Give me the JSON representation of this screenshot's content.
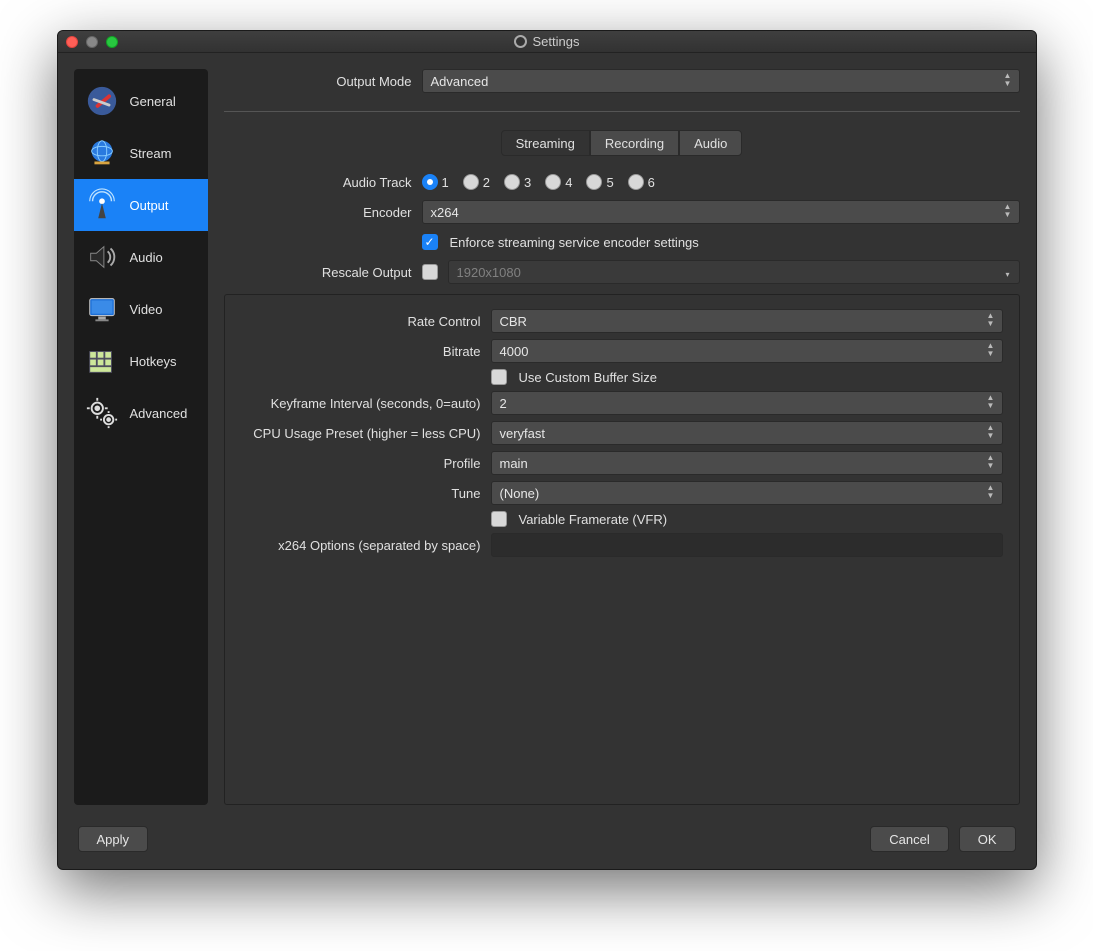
{
  "window": {
    "title": "Settings"
  },
  "sidebar": {
    "items": [
      {
        "label": "General"
      },
      {
        "label": "Stream"
      },
      {
        "label": "Output"
      },
      {
        "label": "Audio"
      },
      {
        "label": "Video"
      },
      {
        "label": "Hotkeys"
      },
      {
        "label": "Advanced"
      }
    ]
  },
  "top": {
    "output_mode_label": "Output Mode",
    "output_mode_value": "Advanced"
  },
  "tabs": {
    "streaming": "Streaming",
    "recording": "Recording",
    "audio": "Audio"
  },
  "stream": {
    "audio_track_label": "Audio Track",
    "tracks": [
      "1",
      "2",
      "3",
      "4",
      "5",
      "6"
    ],
    "encoder_label": "Encoder",
    "encoder_value": "x264",
    "enforce_label": "Enforce streaming service encoder settings",
    "rescale_label": "Rescale Output",
    "rescale_value": "1920x1080"
  },
  "enc": {
    "rate_control_label": "Rate Control",
    "rate_control_value": "CBR",
    "bitrate_label": "Bitrate",
    "bitrate_value": "4000",
    "custom_buffer_label": "Use Custom Buffer Size",
    "keyframe_label": "Keyframe Interval (seconds, 0=auto)",
    "keyframe_value": "2",
    "cpu_label": "CPU Usage Preset (higher = less CPU)",
    "cpu_value": "veryfast",
    "profile_label": "Profile",
    "profile_value": "main",
    "tune_label": "Tune",
    "tune_value": "(None)",
    "vfr_label": "Variable Framerate (VFR)",
    "x264opts_label": "x264 Options (separated by space)",
    "x264opts_value": ""
  },
  "footer": {
    "apply": "Apply",
    "cancel": "Cancel",
    "ok": "OK"
  }
}
